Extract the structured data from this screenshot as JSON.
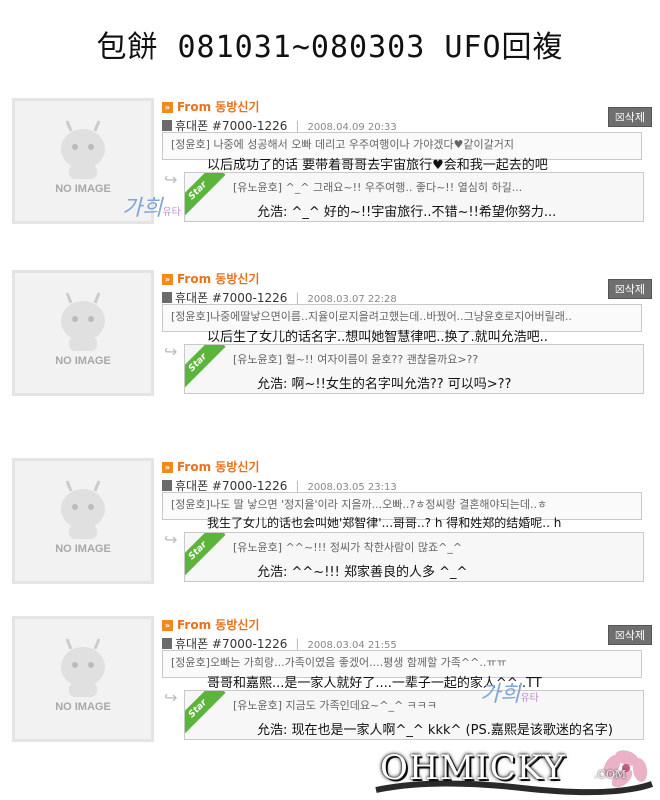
{
  "title": "包餅 081031~080303 UFO回複",
  "colors": {
    "from": "#e8721c",
    "star": "#5cb43a",
    "delete": "#6f6f6f"
  },
  "noimage": "NO IMAGE",
  "from_label": "From 동방신기",
  "star": "Star",
  "delete": "삭제",
  "cards": [
    {
      "sender": "휴대폰 #7000-1226",
      "date": "2008.04.09 20:33",
      "message": "[정윤호] 나중에 성공해서 오빠 데리고 우주여행이나 가야겠다♥같이갈거지",
      "message_cn": "以后成功了的话 要带着哥哥去宇宙旅行♥会和我一起去的吧",
      "reply": "[유노윤호] ^_^ 그래요~!! 우주여행.. 좋다~!! 열심히 하길...",
      "reply_cn": "允浩: ^_^ 好的~!!宇宙旅行..不错~!!希望你努力..."
    },
    {
      "sender": "휴대폰 #7000-1226",
      "date": "2008.03.07 22:28",
      "message": "[정윤호]나중에딸낳으면이름..지율이로지을려고했는데..바꿨어..그냥윤호로지어버릴래..",
      "message_cn": "以后生了女儿的话名字..想叫她智慧律吧..换了.就叫允浩吧..",
      "reply": "[유노윤호] 헐~!! 여자이름이 윤호?? 괜찮을까요>??",
      "reply_cn": "允浩: 啊~!!女生的名字叫允浩?? 可以吗>??"
    },
    {
      "sender": "휴대폰 #7000-1226",
      "date": "2008.03.05 23:13",
      "message": "[정윤호]나도 딸 낳으면 '정지율'이라 지을까...오빠..?ㅎ정씨랑 결혼해야되는데..ㅎ",
      "message_cn": "我生了女儿的话也会叫她'郑智律'...哥哥..? h 得和姓郑的结婚呢.. h",
      "reply": "[유노윤호] ^^~!!! 정씨가 착한사람이 많죠^_^",
      "reply_cn": "允浩: ^^~!!! 郑家善良的人多 ^_^"
    },
    {
      "sender": "휴대폰 #7000-1226",
      "date": "2008.03.04 21:55",
      "message": "[정윤호]오빠는 가희랑...가족이였음 좋겠어....평생 함께할 가족^^..ㅠㅠ",
      "message_cn": "哥哥和嘉熙...是一家人就好了....一辈子一起的家人^^..TT",
      "reply": "[유노윤호] 지금도 가족인데요~^_^ ㅋㅋㅋ",
      "reply_cn": "允浩: 现在也是一家人啊^_^ kkk^ (PS.嘉熙是该歌迷的名字)"
    }
  ],
  "signature": {
    "name": "가희",
    "sub": "유타"
  },
  "logo": {
    "main": "OHMICKY",
    "suffix": ".COM"
  }
}
